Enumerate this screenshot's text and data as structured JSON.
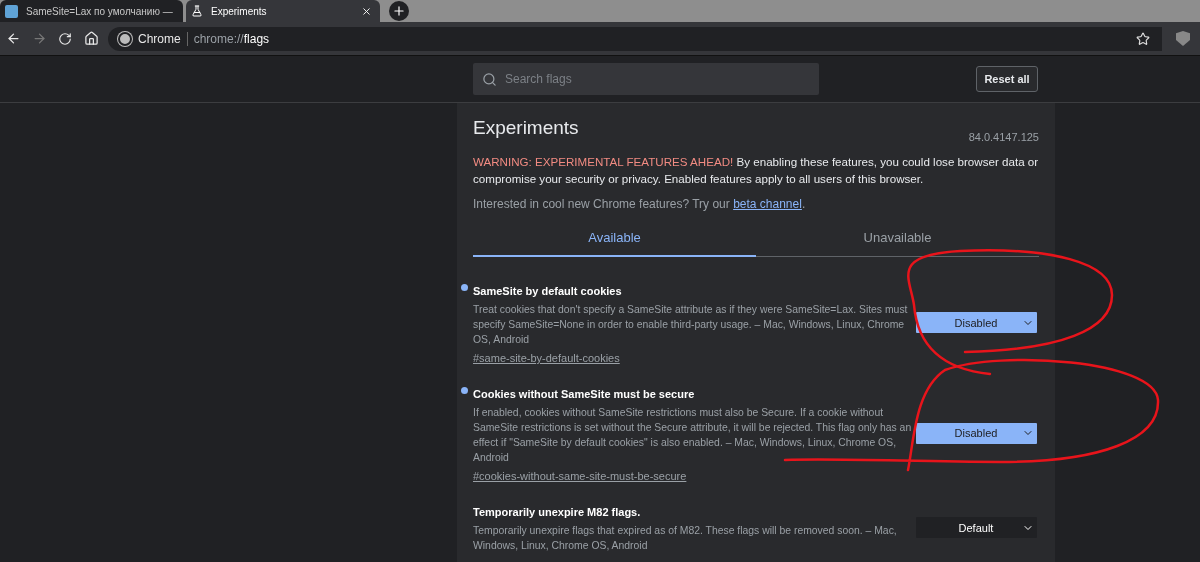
{
  "tabs": [
    {
      "title": "SameSite=Lax по умолчанию —",
      "selected": false
    },
    {
      "title": "Experiments",
      "selected": true
    }
  ],
  "address": {
    "site_label": "Chrome",
    "scheme": "chrome://",
    "path": "flags"
  },
  "search": {
    "placeholder": "Search flags"
  },
  "reset_button": "Reset all",
  "title": "Experiments",
  "version": "84.0.4147.125",
  "warning_lead": "WARNING: EXPERIMENTAL FEATURES AHEAD!",
  "warning_text": " By enabling these features, you could lose browser data or compromise your security or privacy. Enabled features apply to all users of this browser.",
  "promo": {
    "text": "Interested in cool new Chrome features? Try our ",
    "link": "beta channel",
    "end": "."
  },
  "section_tabs": [
    {
      "label": "Available",
      "selected": true
    },
    {
      "label": "Unavailable",
      "selected": false
    }
  ],
  "flags": [
    {
      "name": "SameSite by default cookies",
      "modified": true,
      "description": "Treat cookies that don't specify a SameSite attribute as if they were SameSite=Lax. Sites must specify SameSite=None in order to enable third-party usage. – Mac, Windows, Linux, Chrome OS, Android",
      "link": "#same-site-by-default-cookies",
      "value": "Disabled"
    },
    {
      "name": "Cookies without SameSite must be secure",
      "modified": true,
      "description": "If enabled, cookies without SameSite restrictions must also be Secure. If a cookie without SameSite restrictions is set without the Secure attribute, it will be rejected. This flag only has an effect if \"SameSite by default cookies\" is also enabled. – Mac, Windows, Linux, Chrome OS, Android",
      "link": "#cookies-without-same-site-must-be-secure",
      "value": "Disabled"
    },
    {
      "name": "Temporarily unexpire M82 flags.",
      "modified": false,
      "description": "Temporarily unexpire flags that expired as of M82. These flags will be removed soon. – Mac, Windows, Linux, Chrome OS, Android",
      "value": "Default"
    }
  ]
}
